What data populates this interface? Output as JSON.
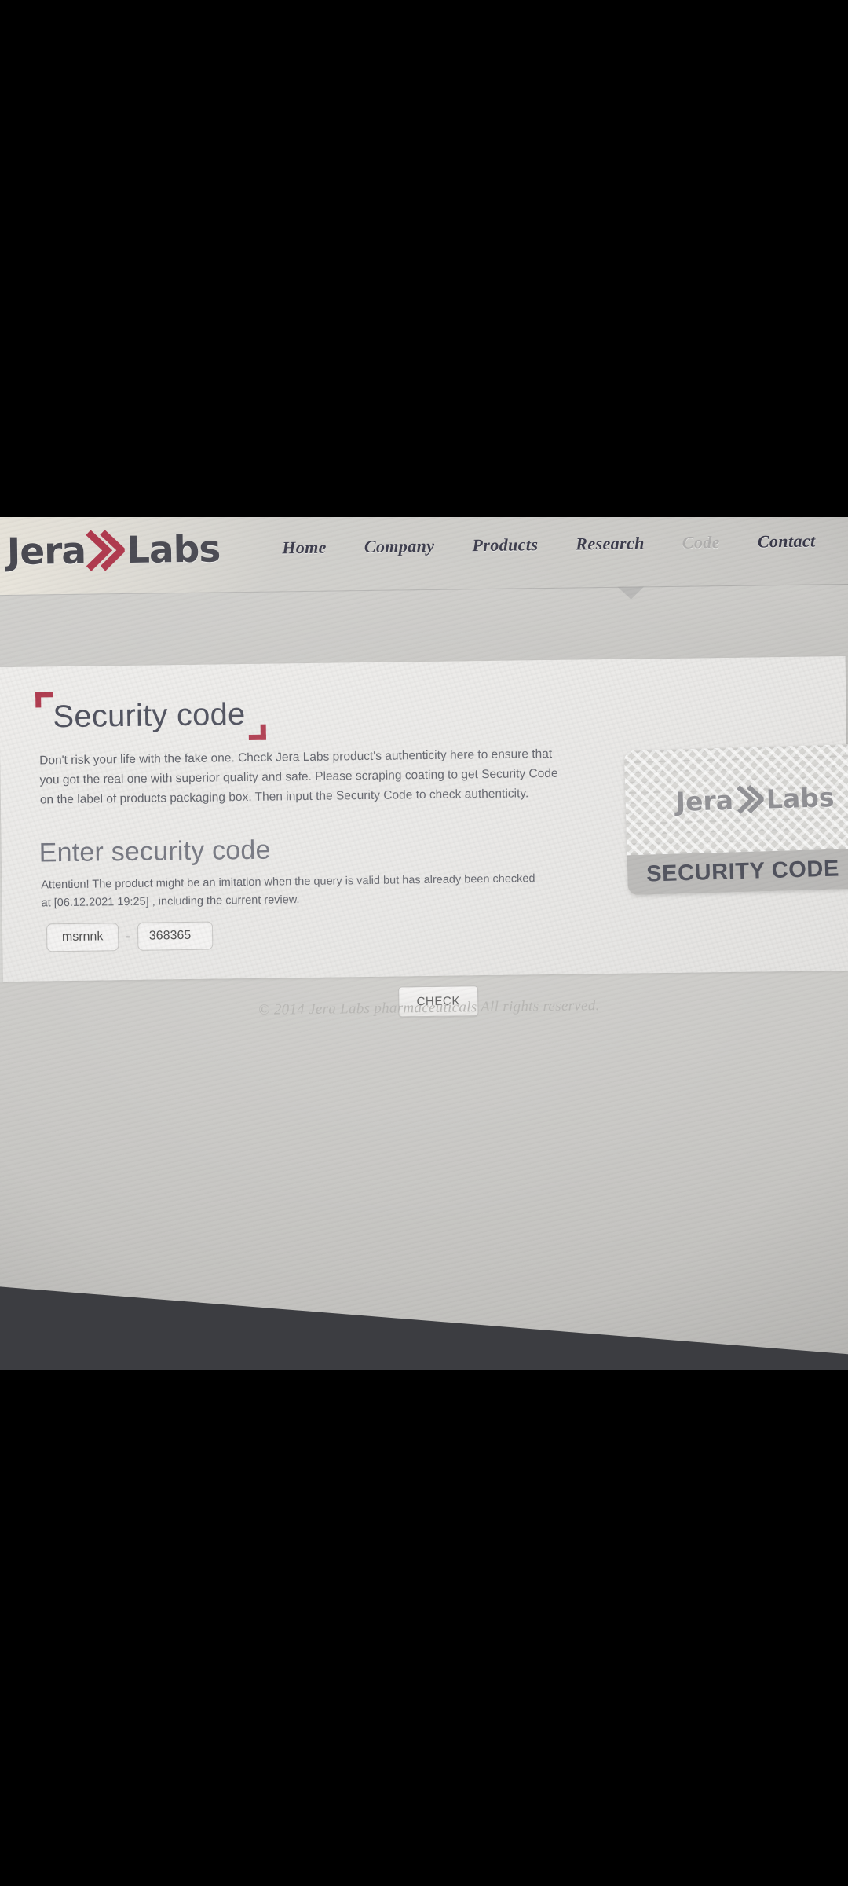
{
  "header": {
    "logo": {
      "first": "Jera",
      "chevron_icon": "double-chevron-right-icon",
      "second": "Labs",
      "accent_color": "#b03a4e"
    },
    "nav": [
      {
        "label": "Home",
        "active": false
      },
      {
        "label": "Company",
        "active": false
      },
      {
        "label": "Products",
        "active": false
      },
      {
        "label": "Research",
        "active": false
      },
      {
        "label": "Code",
        "active": true
      },
      {
        "label": "Contact",
        "active": false
      }
    ]
  },
  "main": {
    "page_title": "Security code",
    "intro": "Don't risk your life with the fake one. Check Jera Labs product's authenticity here to ensure that you got the real one with superior quality and safe. Please scraping coating to get Security Code on the label of products packaging box. Then input the Security Code to check authenticity.",
    "section_title": "Enter security code",
    "attention": "Attention! The product might be an imitation when the query is valid but has already been checked at [06.12.2021 19:25] , including the current review.",
    "code": {
      "part1_value": "msrnnk",
      "part1_placeholder": "",
      "separator": "-",
      "part2_value": "368365",
      "part2_placeholder": ""
    },
    "check_button": "CHECK"
  },
  "scratch_card": {
    "logo_first": "Jera",
    "logo_second": "Labs",
    "band_label": "SECURITY CODE"
  },
  "footer": {
    "copyright": "© 2014 Jera Labs pharmaceuticals All rights reserved."
  }
}
